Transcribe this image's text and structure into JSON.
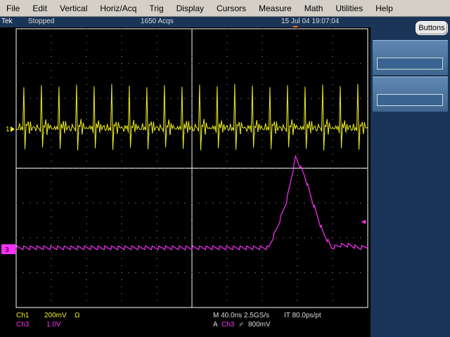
{
  "menu": [
    "File",
    "Edit",
    "Vertical",
    "Horiz/Acq",
    "Trig",
    "Display",
    "Cursors",
    "Measure",
    "Math",
    "Utilities",
    "Help"
  ],
  "status": {
    "brand": "Tek",
    "state": "Stopped",
    "acquisitions": "1650 Acqs",
    "datetime": "15 Jul 04 19:07:04"
  },
  "side_panel": {
    "buttons_label": "Buttons"
  },
  "channels": {
    "ch1": {
      "marker": "1",
      "name": "Ch1",
      "scale": "200mV",
      "coupling": "Ω",
      "color": "#f0f020"
    },
    "ch3": {
      "marker": "3",
      "name": "Ch3",
      "scale": "1.0V",
      "color": "#ff30ff"
    }
  },
  "timebase": {
    "horizontal": "M 40.0ns 2.5GS/s",
    "interp": "IT 80.0ps/pt"
  },
  "trigger": {
    "mode": "A",
    "source": "Ch3",
    "slope_icon": "rising-edge-icon",
    "slope_glyph": "⌿",
    "level": "800mV"
  },
  "colors": {
    "background": "#000000",
    "graticule": "#ffffff",
    "panel": "#1a3557",
    "trigger_marker": "#ff6a1a"
  },
  "chart_data": {
    "type": "line",
    "series": [
      {
        "name": "Ch1",
        "values": [
          0.05,
          0.0,
          -0.02,
          0.1,
          0.0,
          0.05,
          -0.05,
          1.0,
          -0.45,
          0.1,
          0.05,
          0.2,
          -0.1,
          0.15,
          0.0,
          0.05
        ]
      },
      {
        "name": "Ch3",
        "values": [
          0.0,
          0.0,
          0.0,
          0.0,
          0.0,
          0.0,
          0.0,
          0.0,
          0.0,
          0.0,
          0.0,
          0.0,
          0.0,
          0.0,
          0.0,
          0.0,
          0.0,
          0.0,
          0.0,
          0.0,
          0.0,
          0.0,
          0.0,
          0.0,
          0.0,
          0.0,
          0.0,
          0.0,
          0.0,
          0.8,
          1.75,
          3.4,
          2.7,
          1.6,
          0.6,
          0.0,
          0.1,
          0.1,
          0.0,
          0.05
        ]
      }
    ]
  }
}
